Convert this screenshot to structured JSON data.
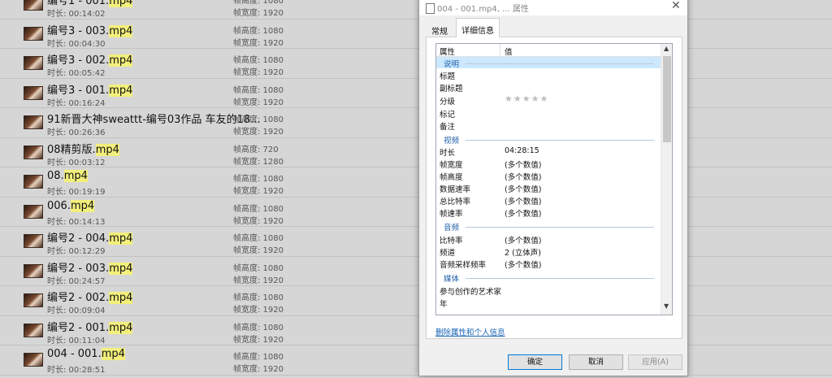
{
  "files": [
    {
      "prefix": "编号1 - 001.",
      "ext": "mp4",
      "duration": "时长: 00:14:02",
      "height": "帧高度: 1080",
      "width": "帧宽度: 1920"
    },
    {
      "prefix": "编号3 - 003.",
      "ext": "mp4",
      "duration": "时长: 00:04:30",
      "height": "帧高度: 1080",
      "width": "帧宽度: 1920"
    },
    {
      "prefix": "编号3 - 002.",
      "ext": "mp4",
      "duration": "时长: 00:05:42",
      "height": "帧高度: 1080",
      "width": "帧宽度: 1920"
    },
    {
      "prefix": "编号3 - 001.",
      "ext": "mp4",
      "duration": "时长: 00:16:24",
      "height": "帧高度: 1080",
      "width": "帧宽度: 1920"
    },
    {
      "prefix": "91新晋大神sweattt-编号03作品 车友的18...",
      "ext": "",
      "duration": "时长: 00:26:36",
      "height": "帧高度: 1080",
      "width": "帧宽度: 1920"
    },
    {
      "prefix": "08精剪版.",
      "ext": "mp4",
      "duration": "时长: 00:03:12",
      "height": "帧高度: 720",
      "width": "帧宽度: 1280"
    },
    {
      "prefix": "08.",
      "ext": "mp4",
      "duration": "时长: 00:19:19",
      "height": "帧高度: 1080",
      "width": "帧宽度: 1920"
    },
    {
      "prefix": "006.",
      "ext": "mp4",
      "duration": "时长: 00:14:13",
      "height": "帧高度: 1080",
      "width": "帧宽度: 1920"
    },
    {
      "prefix": "编号2 - 004.",
      "ext": "mp4",
      "duration": "时长: 00:12:29",
      "height": "帧高度: 1080",
      "width": "帧宽度: 1920"
    },
    {
      "prefix": "编号2 - 003.",
      "ext": "mp4",
      "duration": "时长: 00:24:57",
      "height": "帧高度: 1080",
      "width": "帧宽度: 1920"
    },
    {
      "prefix": "编号2 - 002.",
      "ext": "mp4",
      "duration": "时长: 00:09:04",
      "height": "帧高度: 1080",
      "width": "帧宽度: 1920"
    },
    {
      "prefix": "编号2 - 001.",
      "ext": "mp4",
      "duration": "时长: 00:11:04",
      "height": "帧高度: 1080",
      "width": "帧宽度: 1920"
    },
    {
      "prefix": "004 - 001.",
      "ext": "mp4",
      "duration": "时长: 00:28:51",
      "height": "帧高度: 1080",
      "width": "帧宽度: 1920"
    }
  ],
  "dialog": {
    "title": "004 - 001.mp4, ... 属性",
    "close": "✕",
    "tabs": {
      "general": "常规",
      "details": "详细信息"
    },
    "header": {
      "property": "属性",
      "value": "值"
    },
    "sections": {
      "description": "说明",
      "video": "视频",
      "audio": "音频",
      "media": "媒体"
    },
    "props": {
      "title": {
        "name": "标题",
        "value": ""
      },
      "subtitle": {
        "name": "副标题",
        "value": ""
      },
      "rating": {
        "name": "分级",
        "stars": "★★★★★"
      },
      "tags": {
        "name": "标记",
        "value": ""
      },
      "comments": {
        "name": "备注",
        "value": ""
      },
      "length": {
        "name": "时长",
        "value": "04:28:15"
      },
      "frame_width": {
        "name": "帧宽度",
        "value": "(多个数值)"
      },
      "frame_height": {
        "name": "帧高度",
        "value": "(多个数值)"
      },
      "data_rate": {
        "name": "数据速率",
        "value": "(多个数值)"
      },
      "total_bitrate": {
        "name": "总比特率",
        "value": "(多个数值)"
      },
      "frame_rate": {
        "name": "帧速率",
        "value": "(多个数值)"
      },
      "bitrate": {
        "name": "比特率",
        "value": "(多个数值)"
      },
      "channels": {
        "name": "频道",
        "value": "2 (立体声)"
      },
      "sample_rate": {
        "name": "音频采样频率",
        "value": "(多个数值)"
      },
      "contributing_artists": {
        "name": "参与创作的艺术家",
        "value": ""
      },
      "year": {
        "name": "年",
        "value": ""
      }
    },
    "remove_link": "删除属性和个人信息",
    "buttons": {
      "ok": "确定",
      "cancel": "取消",
      "apply": "应用(A)"
    }
  }
}
